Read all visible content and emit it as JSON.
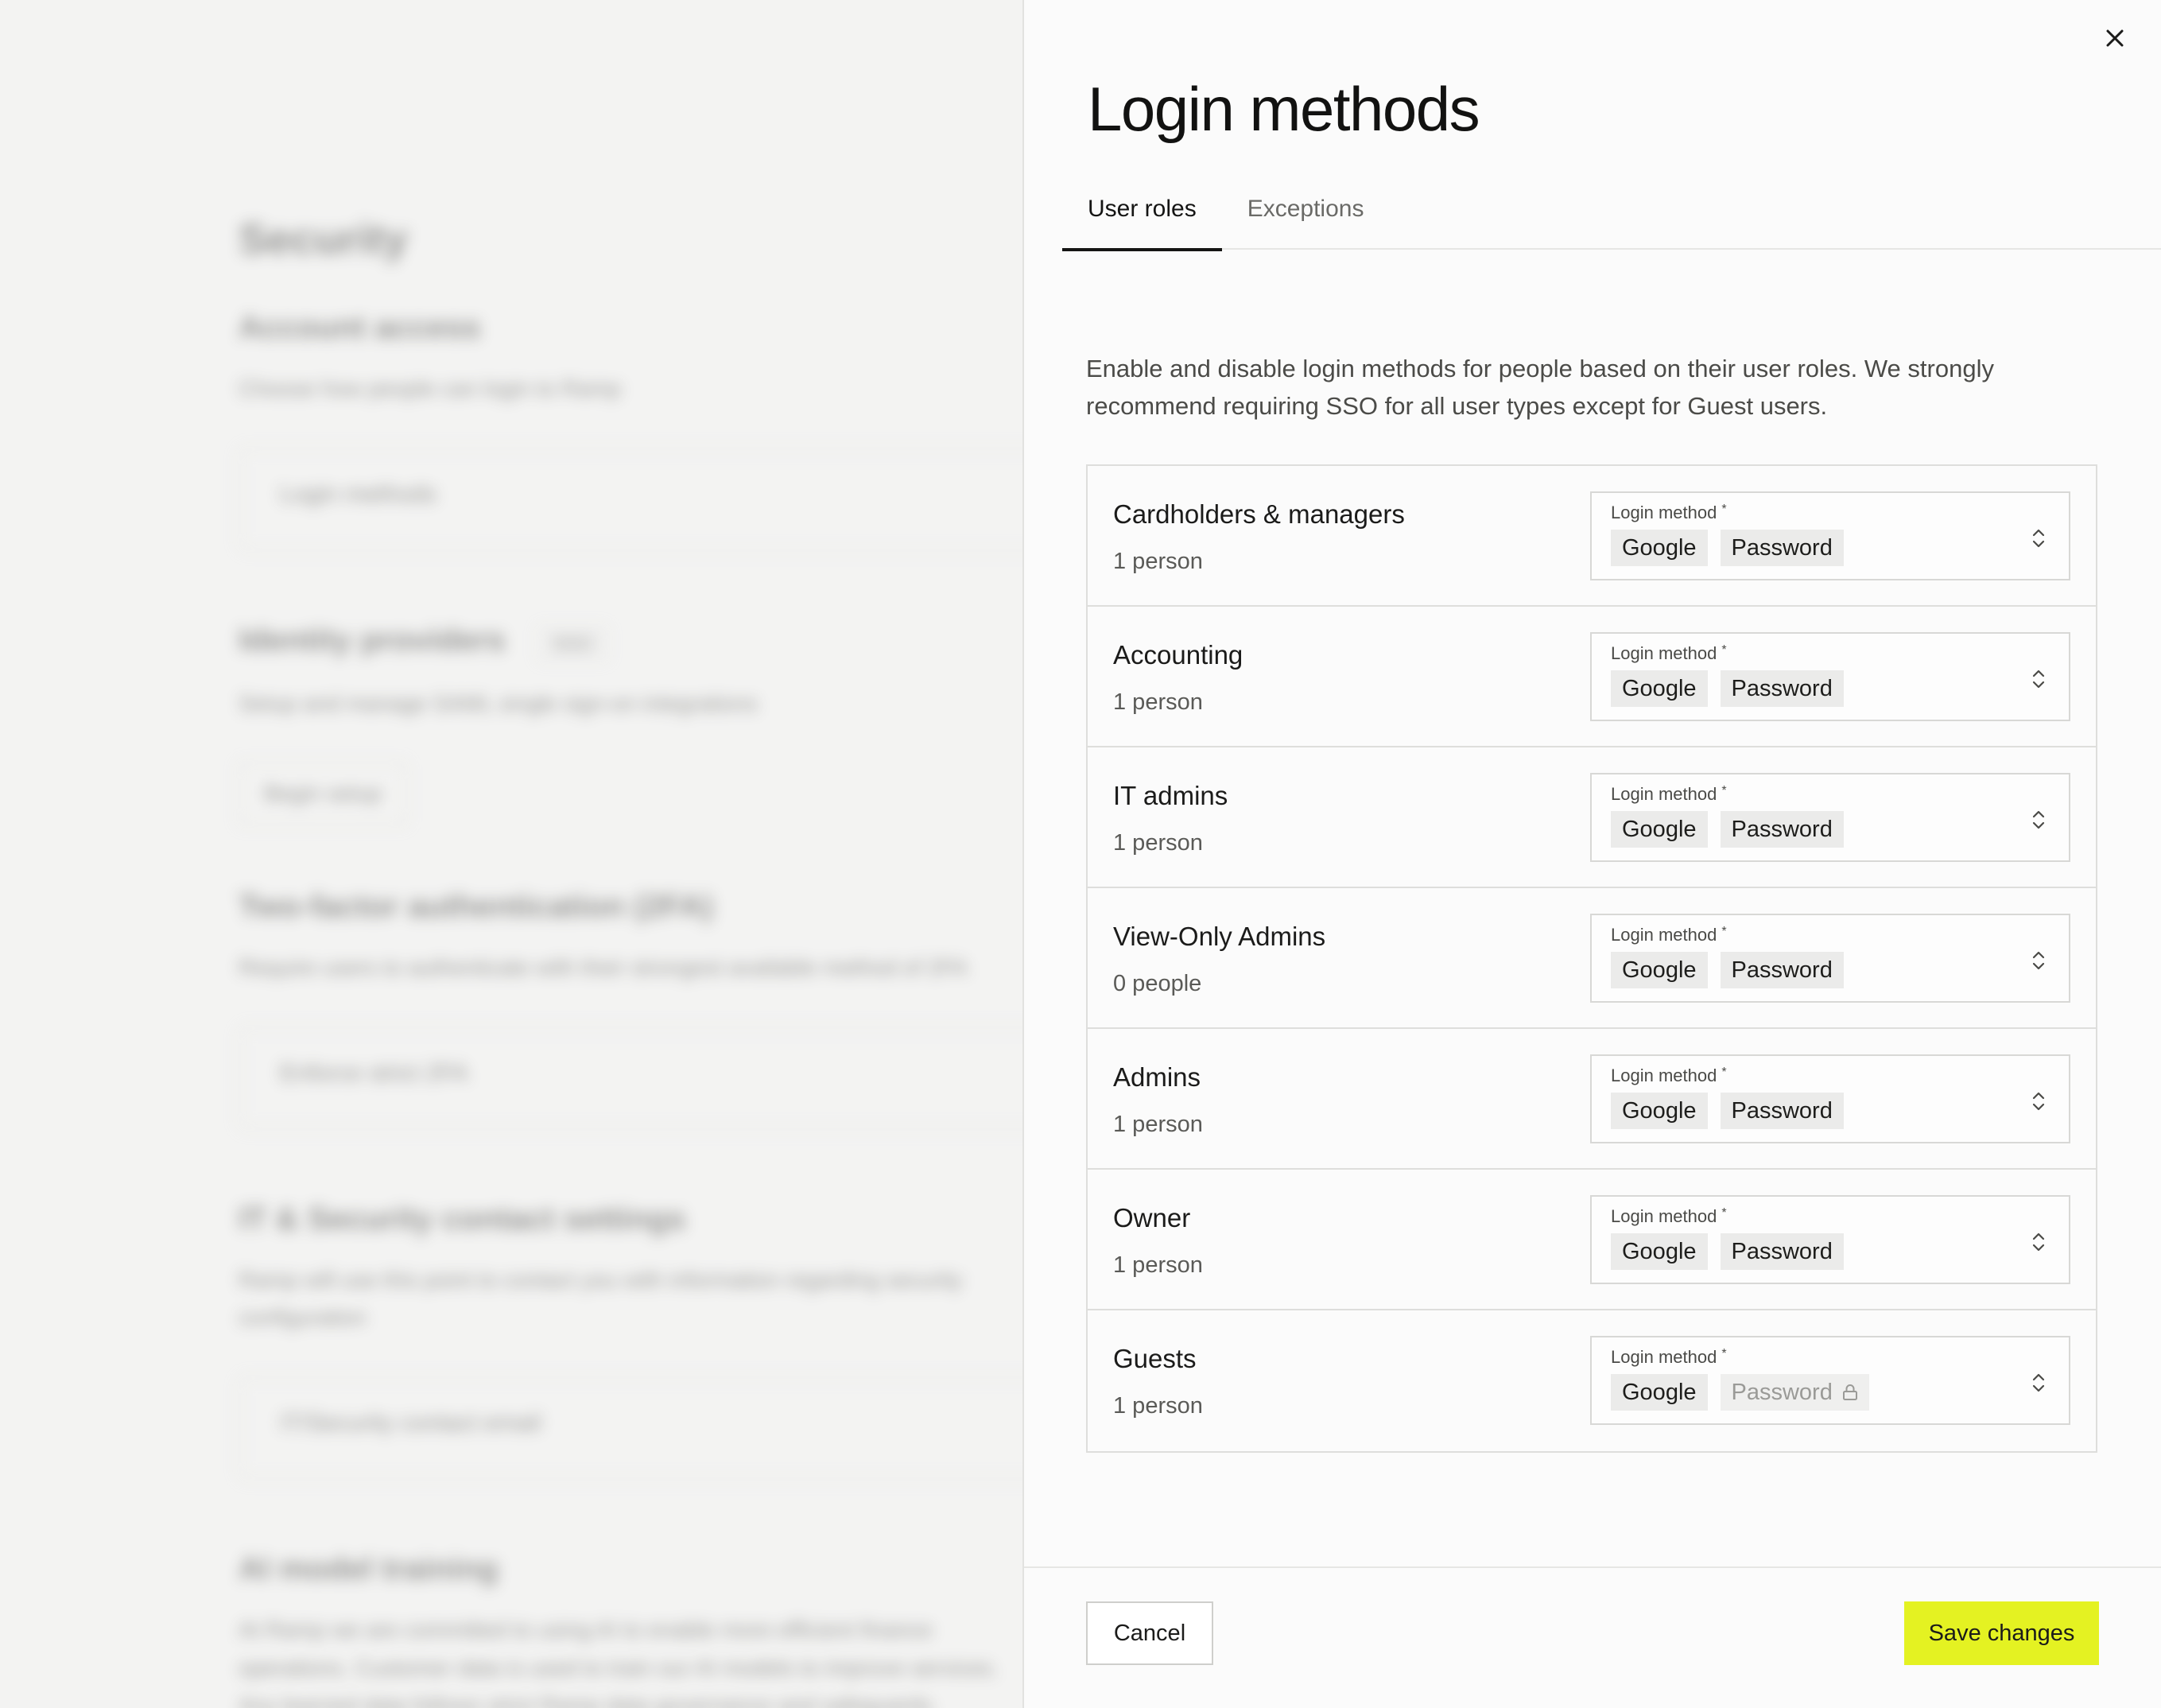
{
  "background_page": {
    "title": "Security",
    "account_access": {
      "heading": "Account access",
      "description": "Choose how people can login to Ramp",
      "card_label": "Login methods"
    },
    "identity_providers": {
      "heading": "Identity providers",
      "badge": "SSO",
      "description": "Setup and manage SAML single sign-on integrations",
      "button_label": "Begin setup"
    },
    "two_factor": {
      "heading": "Two-factor authentication (2FA)",
      "description": "Require users to authenticate with their strongest available method of 2FA",
      "card_label": "Enforce strict 2FA"
    },
    "it_contact": {
      "heading": "IT & Security contact settings",
      "description": "Ramp will use this point to contact you with information regarding security configuration",
      "card_label": "IT/Security contact email"
    },
    "ai_training": {
      "heading": "AI model training",
      "description": "At Ramp we are committed to using AI to enable more efficient finance operations. Customer data is used to train our AI models to improve services. Any learned data follows strict Ramp data governance and safeguards."
    }
  },
  "drawer": {
    "title": "Login methods",
    "close_icon": "close-icon",
    "tabs": [
      {
        "label": "User roles",
        "active": true
      },
      {
        "label": "Exceptions",
        "active": false
      }
    ],
    "description": "Enable and disable login methods for people based on their user roles. We strongly recommend requiring SSO for all user types except for Guest users.",
    "select_label": "Login method",
    "required_marker": "*",
    "roles": [
      {
        "name": "Cardholders & managers",
        "count": "1 person",
        "methods": [
          {
            "label": "Google",
            "disabled": false
          },
          {
            "label": "Password",
            "disabled": false
          }
        ]
      },
      {
        "name": "Accounting",
        "count": "1 person",
        "methods": [
          {
            "label": "Google",
            "disabled": false
          },
          {
            "label": "Password",
            "disabled": false
          }
        ]
      },
      {
        "name": "IT admins",
        "count": "1 person",
        "methods": [
          {
            "label": "Google",
            "disabled": false
          },
          {
            "label": "Password",
            "disabled": false
          }
        ]
      },
      {
        "name": "View-Only Admins",
        "count": "0 people",
        "methods": [
          {
            "label": "Google",
            "disabled": false
          },
          {
            "label": "Password",
            "disabled": false
          }
        ]
      },
      {
        "name": "Admins",
        "count": "1 person",
        "methods": [
          {
            "label": "Google",
            "disabled": false
          },
          {
            "label": "Password",
            "disabled": false
          }
        ]
      },
      {
        "name": "Owner",
        "count": "1 person",
        "methods": [
          {
            "label": "Google",
            "disabled": false
          },
          {
            "label": "Password",
            "disabled": false
          }
        ]
      },
      {
        "name": "Guests",
        "count": "1 person",
        "methods": [
          {
            "label": "Google",
            "disabled": false
          },
          {
            "label": "Password",
            "disabled": true,
            "icon": "lock-icon"
          }
        ]
      }
    ],
    "footer": {
      "cancel_label": "Cancel",
      "save_label": "Save changes"
    }
  },
  "colors": {
    "accent": "#e4f222",
    "text": "#1d1d1b",
    "border": "#dededc",
    "chip_bg": "#ebebea"
  }
}
